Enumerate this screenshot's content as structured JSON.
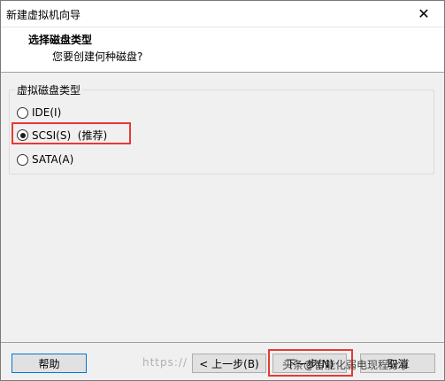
{
  "window": {
    "title": "新建虚拟机向导",
    "close_glyph": "✕"
  },
  "header": {
    "title": "选择磁盘类型",
    "subtitle": "您要创建何种磁盘?"
  },
  "disk_type": {
    "group_label": "虚拟磁盘类型",
    "options": [
      {
        "label": "IDE(I)",
        "selected": false
      },
      {
        "label": "SCSI(S)  (推荐)",
        "selected": true
      },
      {
        "label": "SATA(A)",
        "selected": false
      }
    ]
  },
  "buttons": {
    "help": "帮助",
    "prev": "< 上一步(B)",
    "next": "下一步(N)",
    "cancel": "取消"
  },
  "watermark": {
    "url": "https://",
    "text": "头条@智能化弱电现程分享"
  },
  "colors": {
    "annotation": "#e53935",
    "focus": "#0078d7"
  }
}
